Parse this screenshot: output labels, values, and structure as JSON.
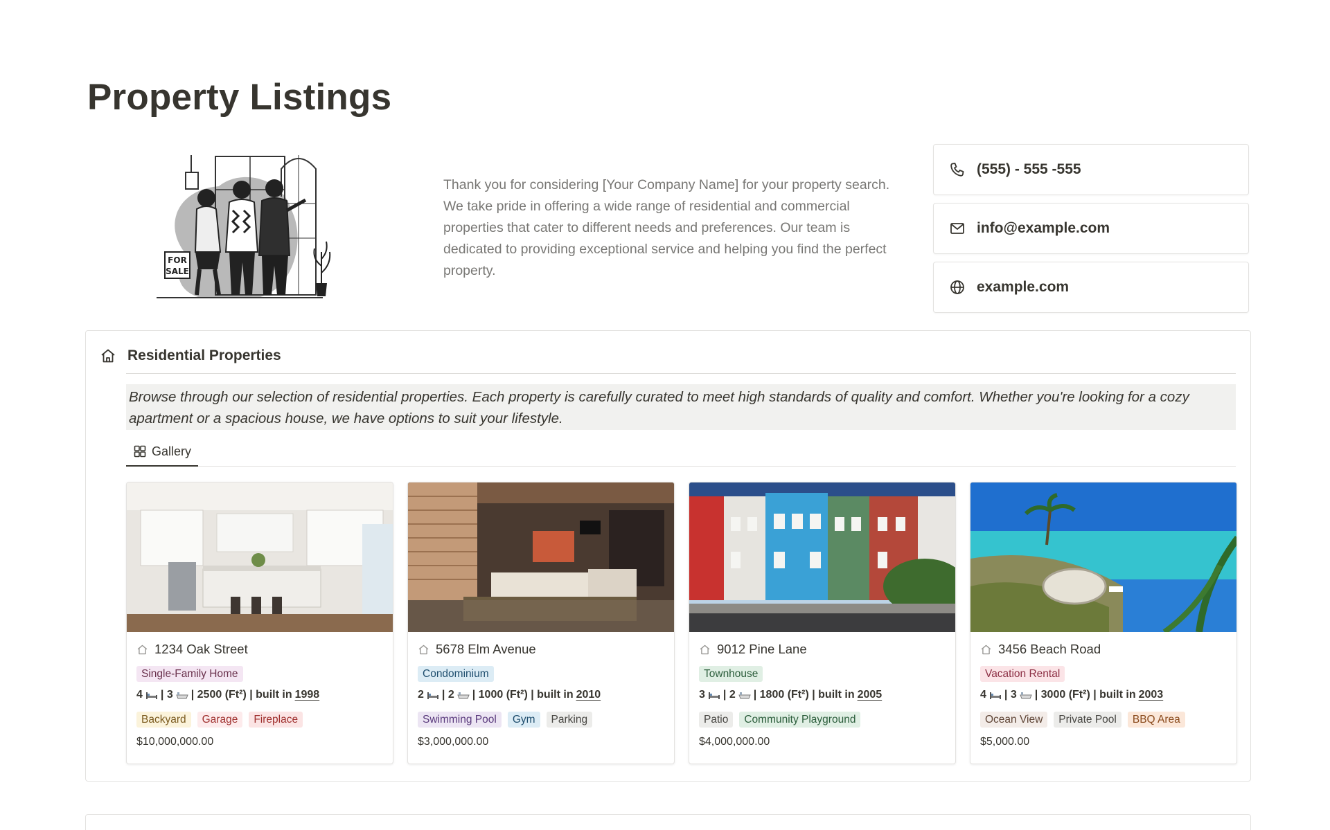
{
  "page": {
    "title": "Property Listings"
  },
  "intro": {
    "text": "Thank you for considering [Your Company Name] for your property search. We take pride in offering a wide range of residential and commercial properties that cater to different needs and preferences. Our team is dedicated to providing exceptional service and helping you find the perfect property.",
    "illustration_sign": "FOR SALE"
  },
  "contacts": [
    {
      "icon": "phone-icon",
      "text": "(555) - 555 -555"
    },
    {
      "icon": "mail-icon",
      "text": "info@example.com"
    },
    {
      "icon": "globe-icon",
      "text": "example.com"
    }
  ],
  "residential": {
    "icon": "home-icon",
    "title": "Residential Properties",
    "callout": "Browse through our selection of residential properties. Each property is carefully curated to meet high standards of quality and comfort. Whether you're looking for a cozy apartment or a spacious house, we have options to suit your lifestyle.",
    "view_tab": {
      "icon": "gallery-icon",
      "label": "Gallery"
    },
    "cards": [
      {
        "name": "1234 Oak Street",
        "type": {
          "label": "Single-Family Home",
          "bg": "#f4e6f3",
          "fg": "#69314c"
        },
        "beds": "4",
        "baths": "3",
        "area": "2500 (Ft²)",
        "built_label": "built in",
        "year": "1998",
        "amenities": [
          {
            "label": "Backyard",
            "bg": "#fbf3db",
            "fg": "#7a5a1e"
          },
          {
            "label": "Garage",
            "bg": "#fdebec",
            "fg": "#9f2f2d"
          },
          {
            "label": "Fireplace",
            "bg": "#fbe4e4",
            "fg": "#9f2f2d"
          }
        ],
        "price": "$10,000,000.00",
        "image": "kitchen"
      },
      {
        "name": "5678 Elm Avenue",
        "type": {
          "label": "Condominium",
          "bg": "#dcecf5",
          "fg": "#1f4e6e"
        },
        "beds": "2",
        "baths": "2",
        "area": "1000 (Ft²)",
        "built_label": "built in",
        "year": "2010",
        "amenities": [
          {
            "label": "Swimming Pool",
            "bg": "#ece5f3",
            "fg": "#5a3a7d"
          },
          {
            "label": "Gym",
            "bg": "#dcecf5",
            "fg": "#1f4e6e"
          },
          {
            "label": "Parking",
            "bg": "#ececea",
            "fg": "#474642"
          }
        ],
        "price": "$3,000,000.00",
        "image": "living-room"
      },
      {
        "name": "9012 Pine Lane",
        "type": {
          "label": "Townhouse",
          "bg": "#e0efe4",
          "fg": "#2b5d3b"
        },
        "beds": "3",
        "baths": "2",
        "area": "1800 (Ft²)",
        "built_label": "built in",
        "year": "2005",
        "amenities": [
          {
            "label": "Patio",
            "bg": "#ececea",
            "fg": "#474642"
          },
          {
            "label": "Community Playground",
            "bg": "#e0efe4",
            "fg": "#2b5d3b"
          }
        ],
        "price": "$4,000,000.00",
        "image": "townhouses"
      },
      {
        "name": "3456 Beach Road",
        "type": {
          "label": "Vacation Rental",
          "bg": "#fbe4e7",
          "fg": "#8c2f44"
        },
        "beds": "4",
        "baths": "3",
        "area": "3000 (Ft²)",
        "built_label": "built in",
        "year": "2003",
        "amenities": [
          {
            "label": "Ocean View",
            "bg": "#f3ece8",
            "fg": "#5e4435"
          },
          {
            "label": "Private Pool",
            "bg": "#ececea",
            "fg": "#474642"
          },
          {
            "label": "BBQ Area",
            "bg": "#fbe7d9",
            "fg": "#8a4a1c"
          }
        ],
        "price": "$5,000.00",
        "image": "beach"
      }
    ]
  }
}
